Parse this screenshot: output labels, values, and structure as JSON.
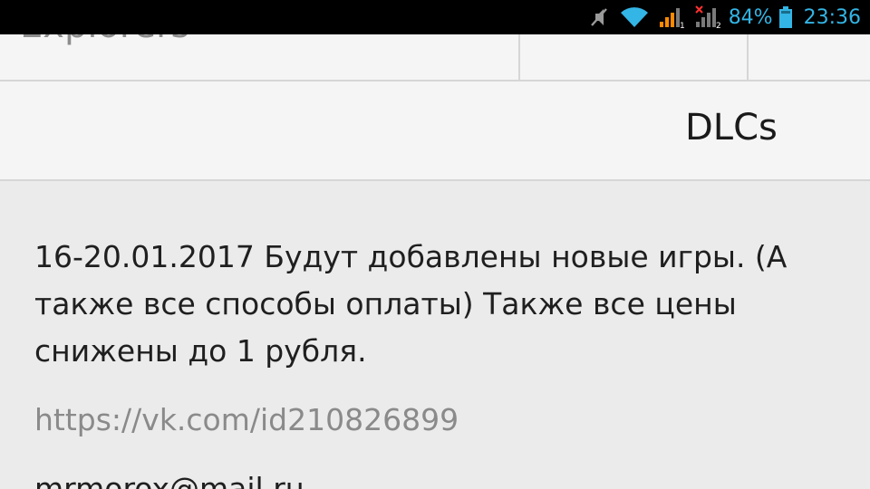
{
  "status_bar": {
    "icons": [
      "mute-icon",
      "wifi-icon",
      "signal-sim1-icon",
      "signal-sim2-no-service-icon",
      "battery-icon"
    ],
    "battery_percent": "84%",
    "time": "23:36",
    "accent_color": "#33b5e5"
  },
  "tabs": {
    "first_label": "Explorers"
  },
  "header": {
    "label": "DLCs"
  },
  "content": {
    "announcement_lines": [
      "16-20.01.2017 Будут добавлены новые игры. (А",
      "также все способы оплаты) Также все цены",
      "снижены до 1 рубля."
    ],
    "link": "https://vk.com/id210826899",
    "email": "mrmorox@mail.ru"
  }
}
